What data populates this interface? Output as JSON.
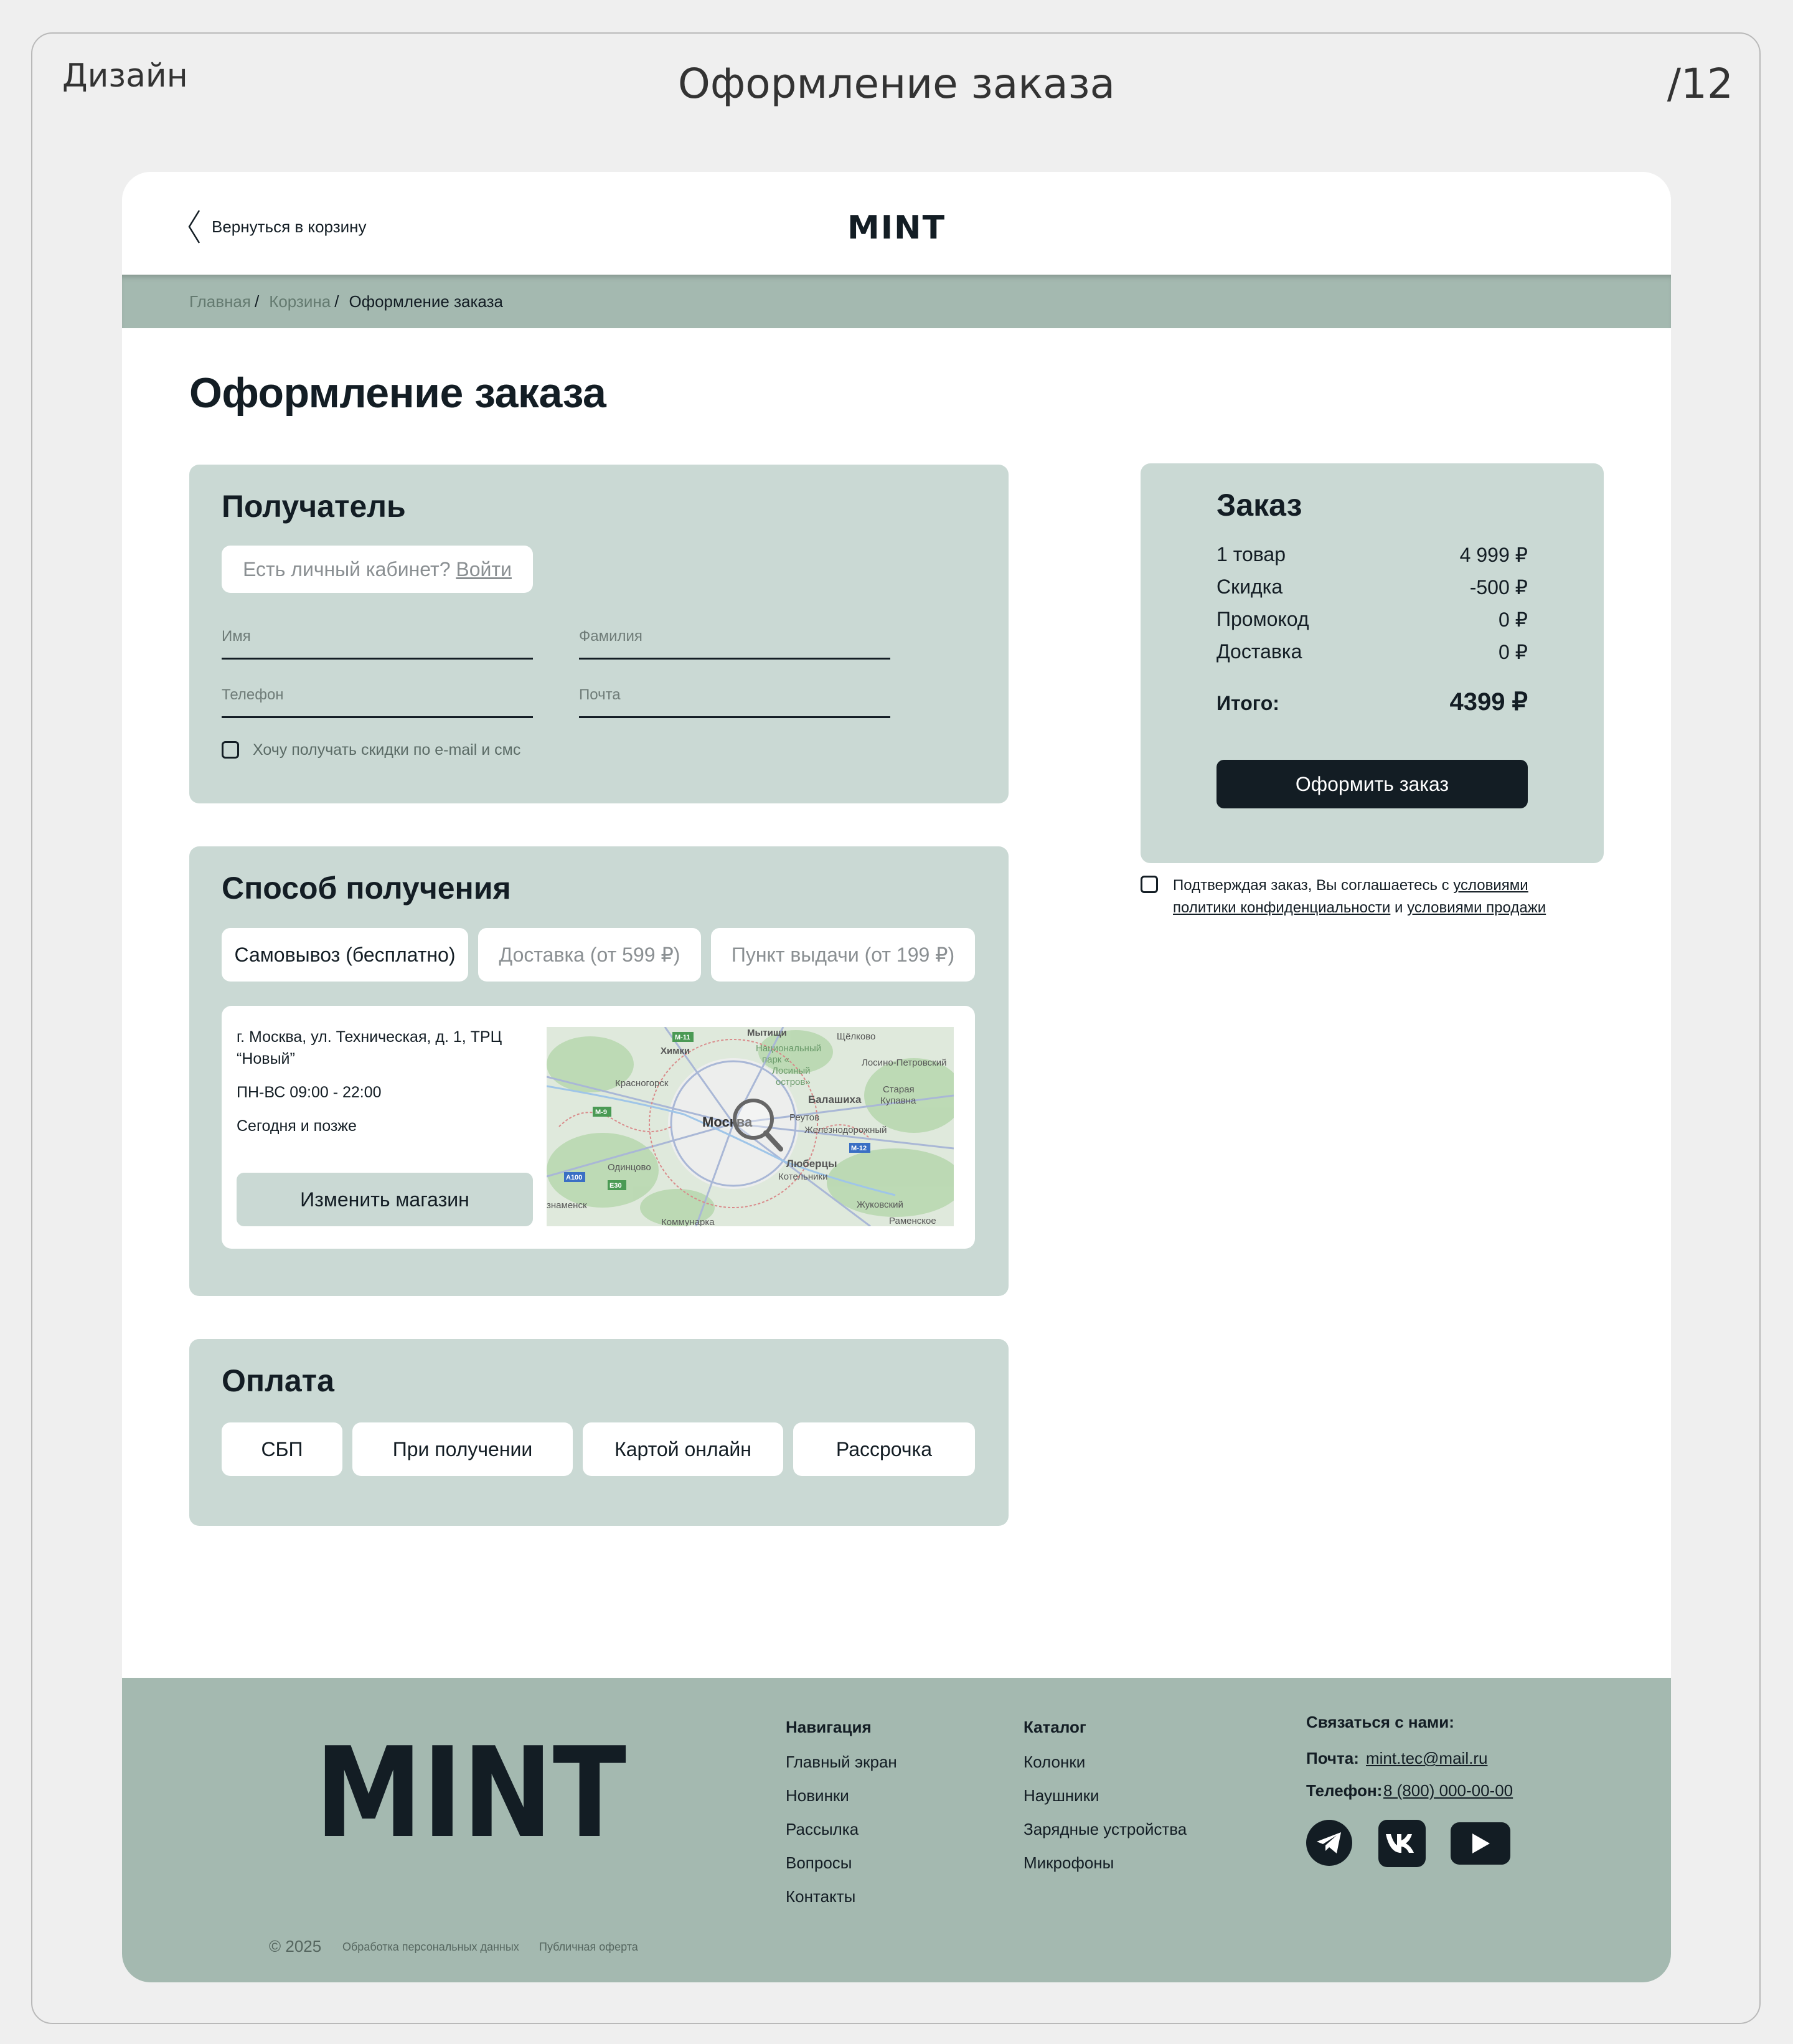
{
  "slide": {
    "label": "Дизайн",
    "title": "Оформление заказа",
    "number": "/12"
  },
  "header": {
    "back_label": "Вернуться в корзину",
    "logo": "MINT"
  },
  "breadcrumbs": {
    "home": "Главная",
    "cart": "Корзина",
    "current": "Оформление заказа",
    "separator": "/"
  },
  "page_title": "Оформление заказа",
  "recipient": {
    "title": "Получатель",
    "account_prompt": "Есть личный кабинет?",
    "login_link": "Войти",
    "first_name_placeholder": "Имя",
    "last_name_placeholder": "Фамилия",
    "phone_placeholder": "Телефон",
    "email_placeholder": "Почта",
    "subscribe_label": "Хочу получать скидки по e-mail и смс"
  },
  "delivery": {
    "title": "Способ получения",
    "options": [
      "Самовывоз (бесплатно)",
      "Доставка (от 599 ₽)",
      "Пункт выдачи (от 199 ₽)"
    ],
    "selected": "Самовывоз (бесплатно)",
    "store": {
      "address_line1": "г. Москва, ул. Техническая, д. 1, ТРЦ",
      "address_line2": "“Новый”",
      "hours": "ПН-ВС 09:00 - 22:00",
      "availability": "Сегодня и позже",
      "change_button": "Изменить магазин"
    },
    "map_labels": {
      "center": "Москва",
      "khimki": "Химки",
      "mytishchi": "Мытищи",
      "national_park_1": "Национальный",
      "national_park_2": "парк «",
      "national_park_3": "Лосиный",
      "national_park_4": "остров»",
      "shchelkovo": "Щёлково",
      "losino": "Лосино-Петровский",
      "krasnogorsk": "Красногорск",
      "balashikha": "Балашиха",
      "staraya_kupavna_1": "Старая",
      "staraya_kupavna_2": "Купавна",
      "reutov": "Реутов",
      "zheleznodorozhny": "Железнодорожный",
      "lyubertsy": "Люберцы",
      "kotelniki": "Котельники",
      "odintsovo": "Одинцово",
      "zhukovsky": "Жуковский",
      "ramenskoye": "Раменское",
      "krasnoznamensk": "знаменск",
      "kommunarka": "Коммунарка",
      "road_m11": "М-11",
      "road_m9": "М-9",
      "road_m12": "М-12",
      "road_a100": "А100",
      "road_e30": "Е30"
    }
  },
  "payment": {
    "title": "Оплата",
    "options": [
      "СБП",
      "При получении",
      "Картой онлайн",
      "Рассрочка"
    ]
  },
  "order": {
    "title": "Заказ",
    "rows": [
      {
        "label": "1 товар",
        "value": "4 999 ₽"
      },
      {
        "label": "Скидка",
        "value": "-500 ₽"
      },
      {
        "label": "Промокод",
        "value": "0 ₽"
      },
      {
        "label": "Доставка",
        "value": "0 ₽"
      }
    ],
    "total_label": "Итого:",
    "total_value": "4399 ₽",
    "submit_button": "Оформить заказ",
    "agreement_prefix": "Подтверждая заказ, Вы соглашаетесь с",
    "agreement_link1": "условиями политики конфиденциальности",
    "agreement_and": "и",
    "agreement_link2": "условиями продажи"
  },
  "footer": {
    "logo": "MINT",
    "navigation": {
      "title": "Навигация",
      "items": [
        "Главный экран",
        "Новинки",
        "Рассылка",
        "Вопросы",
        "Контакты"
      ]
    },
    "catalog": {
      "title": "Каталог",
      "items": [
        "Колонки",
        "Наушники",
        "Зарядные устройства",
        "Микрофоны"
      ]
    },
    "contacts": {
      "title": "Связаться с нами:",
      "email_label": "Почта:",
      "email": "mint.tec@mail.ru",
      "phone_label": "Телефон:",
      "phone": "8 (800) 000-00-00"
    },
    "social_icons": [
      "telegram-icon",
      "vk-icon",
      "youtube-icon"
    ],
    "copyright": "© 2025",
    "privacy_link": "Обработка персональных данных",
    "offer_link": "Публичная оферта"
  },
  "colors": {
    "dark": "#131d24",
    "panel": "#cad9d4",
    "footer": "#a4b9b0",
    "page": "#efefef"
  }
}
